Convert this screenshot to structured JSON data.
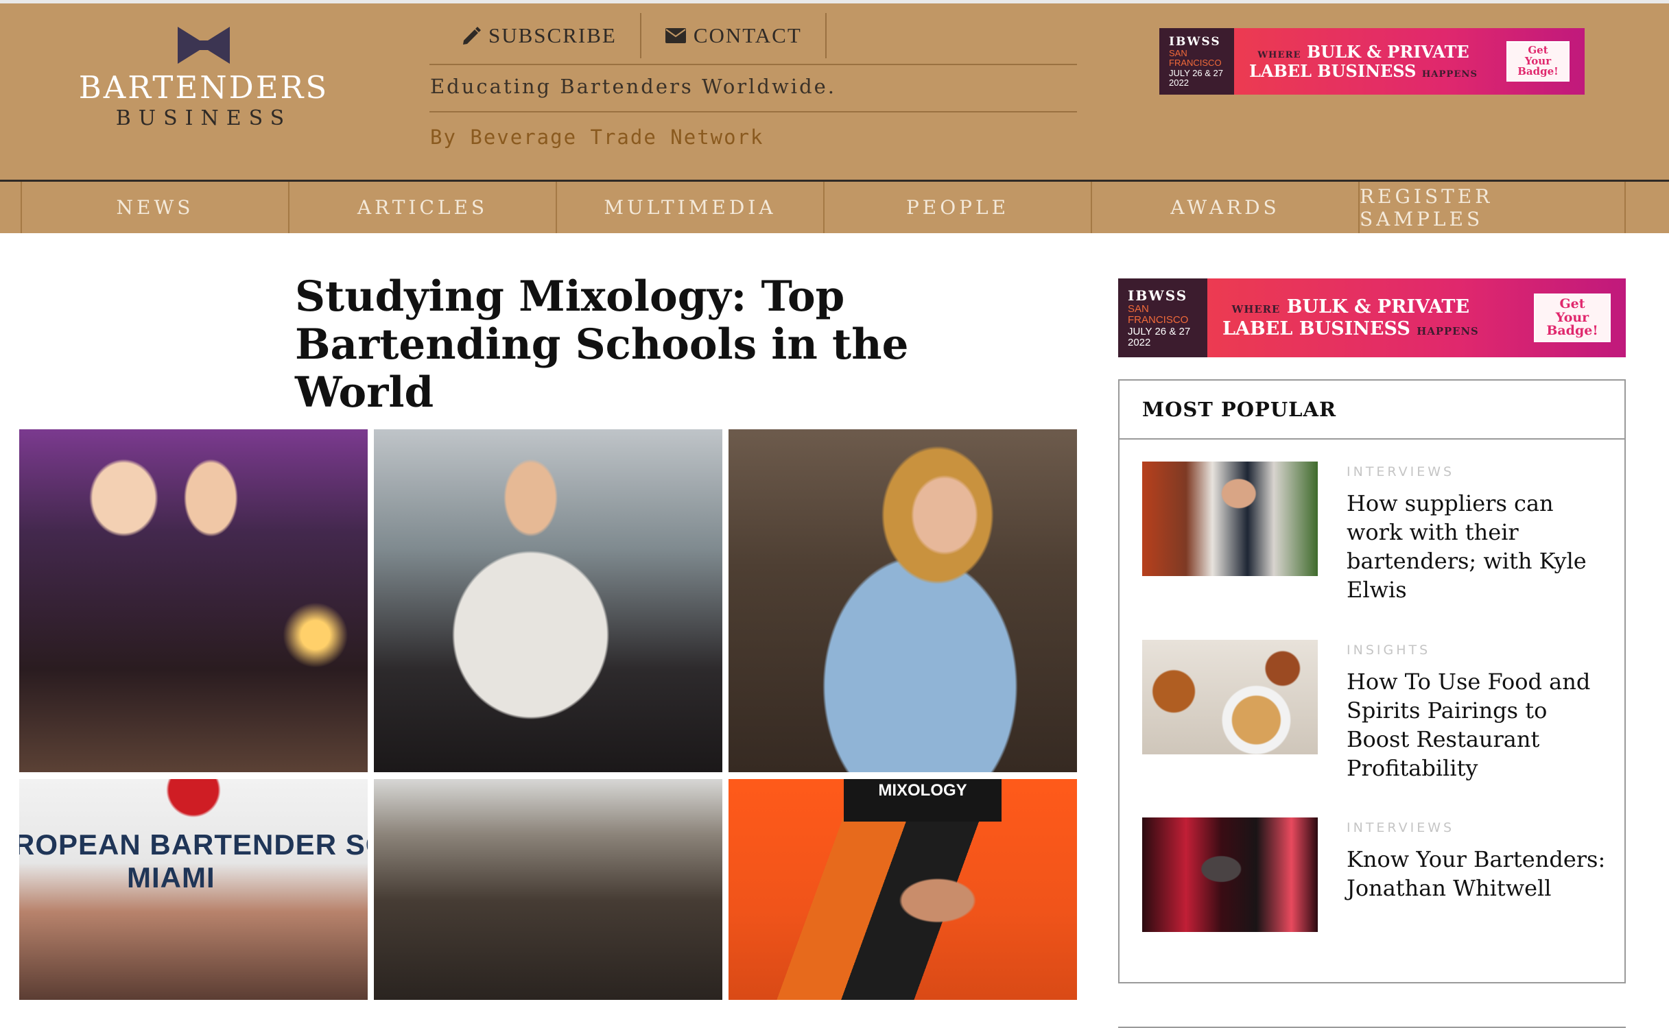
{
  "brand": {
    "logo_top": "BARTENDERS",
    "logo_bottom": "BUSINESS",
    "tagline": "Educating Bartenders Worldwide.",
    "byline": "By Beverage Trade Network"
  },
  "top_links": {
    "subscribe": "SUBSCRIBE",
    "contact": "CONTACT"
  },
  "ad": {
    "brand": "IBWSS",
    "city": "SAN FRANCISCO",
    "date_line1": "JULY 26 & 27",
    "date_line2": "2022",
    "where": "WHERE",
    "headline_1": "BULK & PRIVATE",
    "headline_2": "LABEL BUSINESS",
    "happens": "HAPPENS",
    "cta": "Get Your Badge!"
  },
  "nav": [
    "NEWS",
    "ARTICLES",
    "MULTIMEDIA",
    "PEOPLE",
    "AWARDS",
    "REGISTER SAMPLES"
  ],
  "article": {
    "title": "Studying Mixology: Top Bartending Schools in the World",
    "photo_4_sign_line1": "ROPEAN BARTENDER SCH",
    "photo_4_sign_line2": "MIAMI",
    "photo_6_sign": "MIXOLOGY"
  },
  "popular": {
    "heading": "MOST POPULAR",
    "items": [
      {
        "category": "INTERVIEWS",
        "title": "How suppliers can work with their bartenders; with Kyle Elwis"
      },
      {
        "category": "INSIGHTS",
        "title": "How To Use Food and Spirits Pairings to Boost Restaurant Profitability"
      },
      {
        "category": "INTERVIEWS",
        "title": "Know Your Bartenders: Jonathan Whitwell"
      }
    ]
  },
  "colors": {
    "header_bg": "#c19765",
    "nav_text": "#f4e9d9",
    "dark": "#2f2a26",
    "ad_pink": "#e0286d",
    "ad_plum": "#3c1c2e"
  },
  "icons": {
    "logo_mark": "bowtie-icon",
    "subscribe": "pencil-icon",
    "contact": "envelope-icon"
  }
}
